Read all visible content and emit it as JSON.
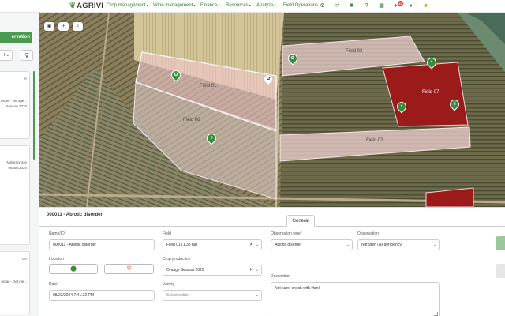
{
  "app": {
    "name": "AGRIVI"
  },
  "nav": [
    {
      "label": "Crop management",
      "has_caret": true
    },
    {
      "label": "Wine management",
      "has_caret": true
    },
    {
      "label": "Finance",
      "has_caret": true
    },
    {
      "label": "Resources",
      "has_caret": true
    },
    {
      "label": "Analyze",
      "has_caret": true
    },
    {
      "label": "Field Operations",
      "has_caret": false
    }
  ],
  "toolbar_icons": [
    "gear-icon",
    "transfer-icon",
    "weather-icon",
    "help-icon",
    "calendar-icon",
    "notifications-icon",
    "chat-icon",
    "user-avatar-icon"
  ],
  "notifications": {
    "count": "48"
  },
  "sidebar": {
    "title_fragment": "ervation",
    "select_fragment": "l",
    "cards": [
      {
        "lines": [
          "er"
        ]
      },
      {
        "lines": [
          "order - Nitroge...",
          "Season 2020"
        ]
      },
      {
        "lines": [
          "Nothracnose",
          "eason 2020"
        ]
      },
      {
        "lines": []
      },
      {
        "lines": [
          "ce!",
          "ordar - Get nie..."
        ]
      }
    ]
  },
  "map": {
    "controls": [
      "eye-icon",
      "plus-icon",
      "zoom-icon"
    ],
    "fields": [
      {
        "id": "field-01",
        "label": "Field 01",
        "highlight": "selected"
      },
      {
        "id": "field-06",
        "label": "Field 06",
        "highlight": "light"
      },
      {
        "id": "field-03",
        "label": "Field 03",
        "highlight": "light"
      },
      {
        "id": "field-07",
        "label": "Field 07",
        "highlight": "red"
      },
      {
        "id": "field-02",
        "label": "Field 02",
        "highlight": "light"
      }
    ]
  },
  "detail": {
    "title": "000011 - Abiotic disorder",
    "tab": "General",
    "name_label": "Name/ID*",
    "name_value": "000011 - Abiotic disorder",
    "location_label": "Location",
    "date_label": "Date*",
    "date_value": "08/23/2024 7:41:22 PM",
    "field_label": "Field",
    "field_value": "Field 01 (1.38 ha)",
    "crop_label": "Crop production",
    "crop_value": "Orange Season 2025",
    "variety_label": "Variety",
    "variety_placeholder": "Select option",
    "obs_type_label": "Observation type*",
    "obs_type_value": "Abiotic disorder",
    "observation_label": "Observation",
    "observation_value": "Nitrogen (N) deficiency",
    "description_label": "Description",
    "description_value": "Not sure, check with Hank"
  },
  "colors": {
    "brand": "#2f7d32",
    "pin": "#3a8a3f",
    "alert_field": "#9b1b1b",
    "action_button": "#9bc79a"
  }
}
